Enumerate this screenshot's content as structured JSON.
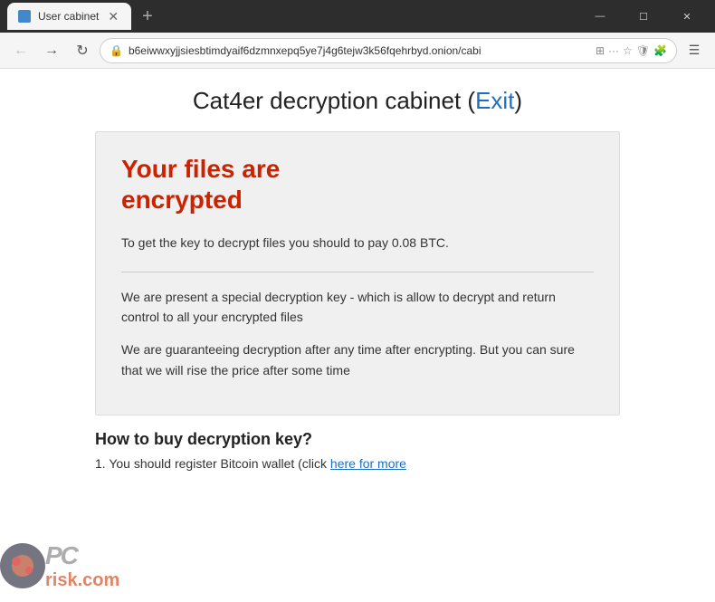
{
  "browser": {
    "tab_title": "User cabinet",
    "address_url": "b6eiwwxyjjsiesbtimdyaif6dzmnxepq5ye7j4g6tejw3k56fqehrbyd.onion/cabi",
    "new_tab_label": "+",
    "window_controls": {
      "minimize": "—",
      "maximize": "☐",
      "close": "✕"
    }
  },
  "page": {
    "title_prefix": "Cat4er decryption cabinet (",
    "title_exit": "Exit",
    "title_suffix": ")",
    "main_heading_line1": "Your files are",
    "main_heading_line2": "encrypted",
    "decrypt_text": "To get the key to decrypt files you should to pay 0.08 BTC.",
    "description1": "We are present a special decryption key - which is allow to decrypt and return control to all your encrypted files",
    "description2": "We are guaranteeing decryption after any time after encrypting. But you can sure that we will rise the price after some time",
    "how_to_title": "How to buy decryption key?",
    "step1_prefix": "1. You should register Bitcoin wallet (click ",
    "step1_link": "here for more",
    "step1_suffix": ""
  },
  "icons": {
    "back_arrow": "←",
    "forward_arrow": "→",
    "refresh": "↻",
    "lock_icon": "🔒",
    "star": "☆",
    "shield": "🛡",
    "menu": "···",
    "extensions": "🧩"
  }
}
